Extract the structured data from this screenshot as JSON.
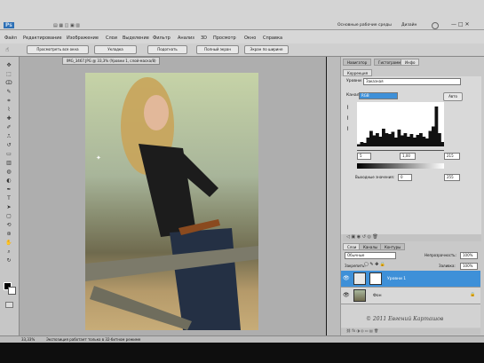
{
  "app": {
    "logo": "Ps",
    "workspace": "Основные рабочие среды",
    "workspace2": "Дизайн",
    "menu": [
      "Файл",
      "Редактирование",
      "Изображение",
      "Слои",
      "Выделение",
      "Фильтр",
      "Анализ",
      "3D",
      "Просмотр",
      "Окно",
      "Справка"
    ],
    "options": [
      "Просмотреть все окна",
      "Укладка",
      "Подогнать",
      "Полный экран",
      "Экран по ширине"
    ]
  },
  "document": {
    "tab": "IMG_3467.JPG @ 33,3% (Уровни 1, слой-маска/8)",
    "status": "Экспозиция работает только в 32-битном режиме"
  },
  "levels": {
    "tabs": [
      "Навигатор",
      "Гистограмма",
      "Инфо"
    ],
    "subtab": "Коррекция",
    "label": "Уровни",
    "preset": "Заказная",
    "channel_label": "Канал:",
    "channel": "RGB",
    "auto": "Авто",
    "inputs": [
      "5",
      "1,00",
      "215"
    ],
    "output_label": "Выходные значения:",
    "outputs": [
      "0",
      "255"
    ],
    "histogram_peaks": [
      0.05,
      0.1,
      0.08,
      0.2,
      0.35,
      0.25,
      0.3,
      0.22,
      0.4,
      0.3,
      0.28,
      0.33,
      0.2,
      0.38,
      0.25,
      0.3,
      0.22,
      0.28,
      0.2,
      0.26,
      0.3,
      0.22,
      0.18,
      0.35,
      0.45,
      0.9,
      0.3,
      0.1
    ]
  },
  "layers": {
    "tabs": [
      "Слои",
      "Каналы",
      "Контуры"
    ],
    "mode": "Обычные",
    "opacity_label": "Непрозрачность:",
    "opacity": "100%",
    "lock_label": "Закрепить:",
    "fill_label": "Заливка:",
    "fill": "100%",
    "items": [
      {
        "name": "Уровни 1",
        "selected": true
      },
      {
        "name": "Фон",
        "selected": false
      }
    ]
  },
  "watermark": "© 2011 Евгений Карташов",
  "colors": {
    "accent": "#3e90d8",
    "panel": "#c9c9c9",
    "canvas": "#aeaeae"
  }
}
